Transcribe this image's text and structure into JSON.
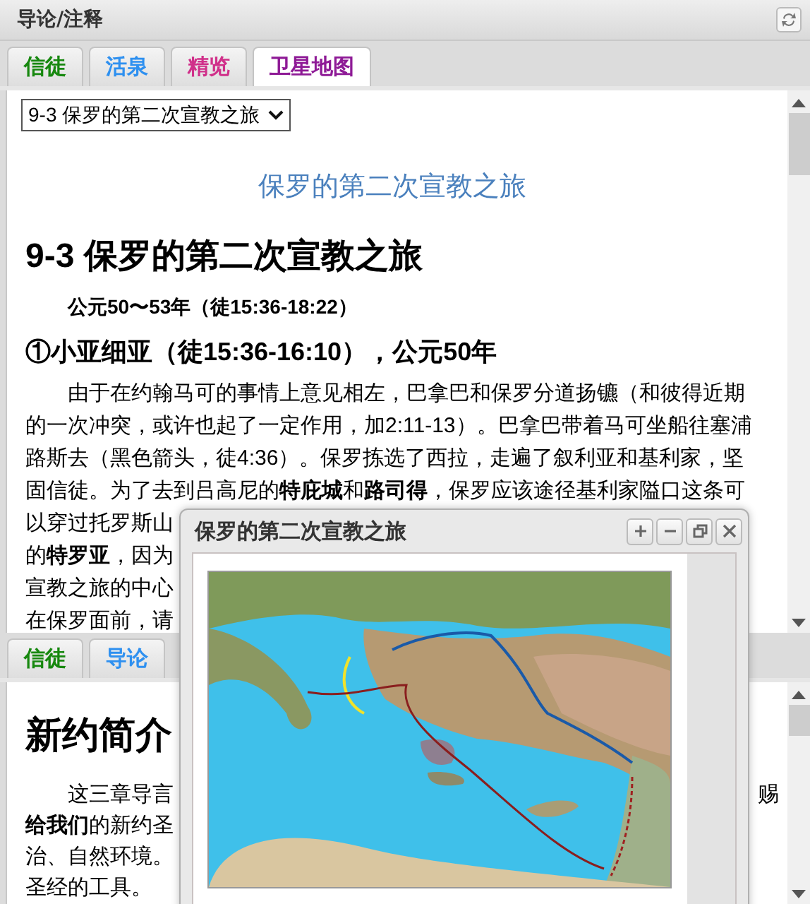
{
  "top_panel": {
    "title": "导论/注释",
    "tabs": [
      {
        "label": "信徒",
        "color": "#17880f",
        "selected": false
      },
      {
        "label": "活泉",
        "color": "#2e90f0",
        "selected": false
      },
      {
        "label": "精览",
        "color": "#d0308a",
        "selected": false
      },
      {
        "label": "卫星地图",
        "color": "#8e1a96",
        "selected": true
      }
    ],
    "chapter_select": {
      "value": "9-3  保罗的第二次宣教之旅"
    },
    "article": [
      {
        "kind": "banner",
        "text": "保罗的第二次宣教之旅"
      },
      {
        "kind": "heading",
        "text": "9-3 保罗的第二次宣教之旅"
      },
      {
        "kind": "subheading",
        "text": "公元50〜53年（徒15:36-18:22）"
      },
      {
        "kind": "section",
        "text": "①小亚细亚（徒15:36-16:10），公元50年"
      },
      {
        "kind": "paragraph",
        "lines": [
          {
            "left": "由于在约翰马可的事情上意见相左，巴拿巴和保罗分道扬镳（和彼得近期"
          },
          {
            "left": "的一次冲突，或许也起了一定作用，加2:11-13）。巴拿巴带着马可坐船往塞浦"
          },
          {
            "left": "路斯去（黑色箭头，徒4:36）。保罗拣选了西拉，走遍了叙利亚和基利家，坚"
          },
          {
            "left": "固信徒。为了去到吕高尼的**特庇城**和**路司得**，保罗应该途径基利家隘口这条可"
          },
          {
            "left": "以穿过托罗斯山"
          },
          {
            "left": "的**特罗亚**，因为"
          },
          {
            "left": "宣教之旅的中心"
          },
          {
            "left": "在保罗面前，请"
          }
        ]
      }
    ]
  },
  "bottom_panel": {
    "tabs": [
      {
        "label": "信徒",
        "color": "#17880f",
        "selected": false
      },
      {
        "label": "导论",
        "color": "#2e90f0",
        "selected": false
      }
    ],
    "article": [
      {
        "kind": "heading",
        "text": "新约简介"
      },
      {
        "kind": "paragraph",
        "lines": [
          {
            "left": "这三章导言",
            "right": "赐"
          },
          {
            "left": "**给我们**的新约圣"
          },
          {
            "left": "治、自然环境。"
          },
          {
            "left": "圣经的工具。"
          }
        ]
      }
    ]
  },
  "popup": {
    "title": "保罗的第二次宣教之旅"
  }
}
